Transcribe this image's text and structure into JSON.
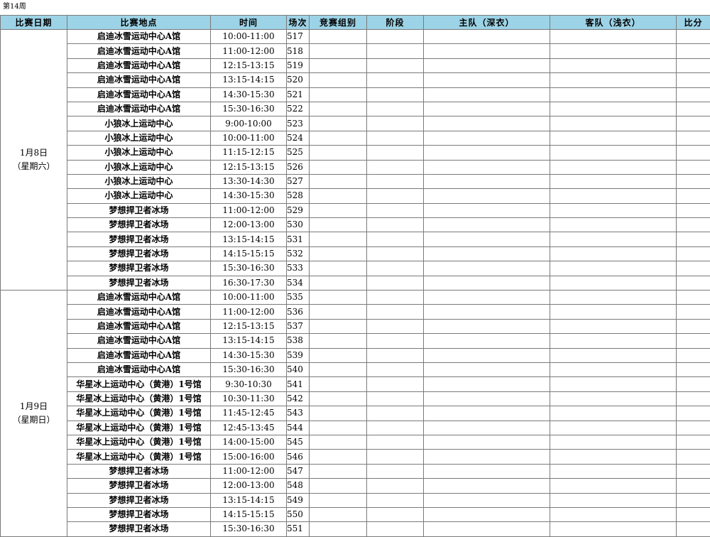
{
  "week_label": "第14周",
  "headers": [
    "比赛日期",
    "比赛地点",
    "时间",
    "场次",
    "竞赛组别",
    "阶段",
    "主队（深衣）",
    "客队（浅衣）",
    "比分"
  ],
  "days": [
    {
      "date": "1月8日",
      "weekday": "（星期六）",
      "rows": [
        {
          "venue": "启迪冰雪运动中心A馆",
          "time": "10:00-11:00",
          "num": "517"
        },
        {
          "venue": "启迪冰雪运动中心A馆",
          "time": "11:00-12:00",
          "num": "518"
        },
        {
          "venue": "启迪冰雪运动中心A馆",
          "time": "12:15-13:15",
          "num": "519"
        },
        {
          "venue": "启迪冰雪运动中心A馆",
          "time": "13:15-14:15",
          "num": "520"
        },
        {
          "venue": "启迪冰雪运动中心A馆",
          "time": "14:30-15:30",
          "num": "521"
        },
        {
          "venue": "启迪冰雪运动中心A馆",
          "time": "15:30-16:30",
          "num": "522"
        },
        {
          "venue": "小狼冰上运动中心",
          "time": "9:00-10:00",
          "num": "523"
        },
        {
          "venue": "小狼冰上运动中心",
          "time": "10:00-11:00",
          "num": "524"
        },
        {
          "venue": "小狼冰上运动中心",
          "time": "11:15-12:15",
          "num": "525"
        },
        {
          "venue": "小狼冰上运动中心",
          "time": "12:15-13:15",
          "num": "526"
        },
        {
          "venue": "小狼冰上运动中心",
          "time": "13:30-14:30",
          "num": "527"
        },
        {
          "venue": "小狼冰上运动中心",
          "time": "14:30-15:30",
          "num": "528"
        },
        {
          "venue": "梦想捍卫者冰场",
          "time": "11:00-12:00",
          "num": "529"
        },
        {
          "venue": "梦想捍卫者冰场",
          "time": "12:00-13:00",
          "num": "530"
        },
        {
          "venue": "梦想捍卫者冰场",
          "time": "13:15-14:15",
          "num": "531"
        },
        {
          "venue": "梦想捍卫者冰场",
          "time": "14:15-15:15",
          "num": "532"
        },
        {
          "venue": "梦想捍卫者冰场",
          "time": "15:30-16:30",
          "num": "533"
        },
        {
          "venue": "梦想捍卫者冰场",
          "time": "16:30-17:30",
          "num": "534"
        }
      ]
    },
    {
      "date": "1月9日",
      "weekday": "（星期日）",
      "rows": [
        {
          "venue": "启迪冰雪运动中心A馆",
          "time": "10:00-11:00",
          "num": "535"
        },
        {
          "venue": "启迪冰雪运动中心A馆",
          "time": "11:00-12:00",
          "num": "536"
        },
        {
          "venue": "启迪冰雪运动中心A馆",
          "time": "12:15-13:15",
          "num": "537"
        },
        {
          "venue": "启迪冰雪运动中心A馆",
          "time": "13:15-14:15",
          "num": "538"
        },
        {
          "venue": "启迪冰雪运动中心A馆",
          "time": "14:30-15:30",
          "num": "539"
        },
        {
          "venue": "启迪冰雪运动中心A馆",
          "time": "15:30-16:30",
          "num": "540"
        },
        {
          "venue": "华星冰上运动中心（黄港）1号馆",
          "time": "9:30-10:30",
          "num": "541"
        },
        {
          "venue": "华星冰上运动中心（黄港）1号馆",
          "time": "10:30-11:30",
          "num": "542"
        },
        {
          "venue": "华星冰上运动中心（黄港）1号馆",
          "time": "11:45-12:45",
          "num": "543"
        },
        {
          "venue": "华星冰上运动中心（黄港）1号馆",
          "time": "12:45-13:45",
          "num": "544"
        },
        {
          "venue": "华星冰上运动中心（黄港）1号馆",
          "time": "14:00-15:00",
          "num": "545"
        },
        {
          "venue": "华星冰上运动中心（黄港）1号馆",
          "time": "15:00-16:00",
          "num": "546"
        },
        {
          "venue": "梦想捍卫者冰场",
          "time": "11:00-12:00",
          "num": "547"
        },
        {
          "venue": "梦想捍卫者冰场",
          "time": "12:00-13:00",
          "num": "548"
        },
        {
          "venue": "梦想捍卫者冰场",
          "time": "13:15-14:15",
          "num": "549"
        },
        {
          "venue": "梦想捍卫者冰场",
          "time": "14:15-15:15",
          "num": "550"
        },
        {
          "venue": "梦想捍卫者冰场",
          "time": "15:30-16:30",
          "num": "551"
        }
      ]
    }
  ]
}
